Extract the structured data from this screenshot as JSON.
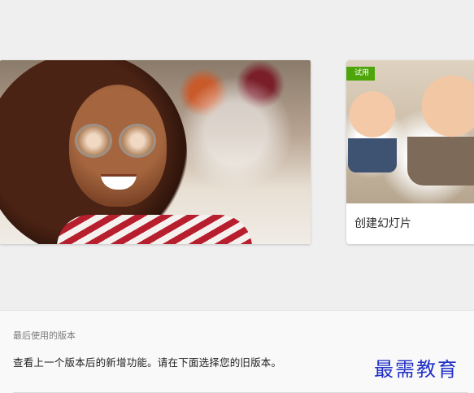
{
  "carousel": {
    "featured_card": {
      "image": "woman-with-sunglasses-photo"
    },
    "side_card": {
      "badge": "试用",
      "title": "创建幻灯片",
      "image": "children-photo"
    }
  },
  "recent_versions": {
    "heading": "最后使用的版本",
    "description": "查看上一个版本后的新增功能。请在下面选择您的旧版本。"
  },
  "watermark": "最需教育",
  "colors": {
    "badge_green": "#4ea50a",
    "watermark_blue": "#2030c8"
  }
}
